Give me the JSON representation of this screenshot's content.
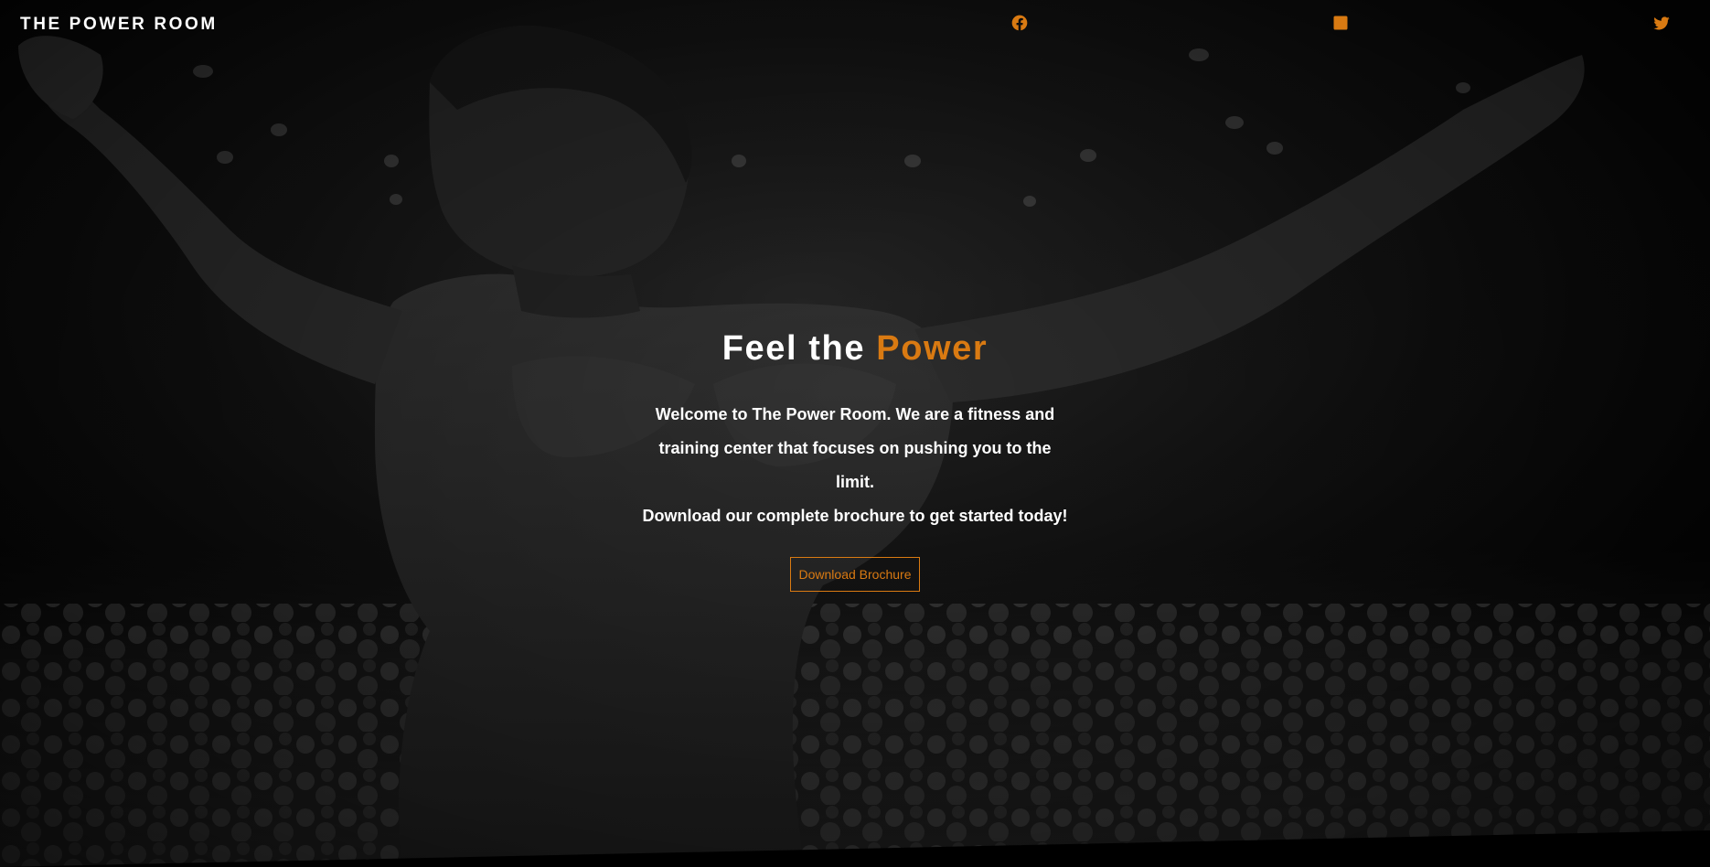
{
  "brand": {
    "name": "THE POWER ROOM"
  },
  "social": {
    "facebook_icon": "facebook-icon",
    "linkedin_icon": "linkedin-icon",
    "twitter_icon": "twitter-icon"
  },
  "hero": {
    "title_prefix": "Feel the ",
    "title_accent": "Power",
    "text_lines": [
      "Welcome to The Power Room. We are a fitness and",
      "training center that focuses on pushing you to the limit.",
      "Download our complete brochure to get started today!"
    ],
    "cta_label": "Download Brochure"
  },
  "colors": {
    "accent": "#d97a12",
    "background": "#000000",
    "text": "#ffffff"
  }
}
